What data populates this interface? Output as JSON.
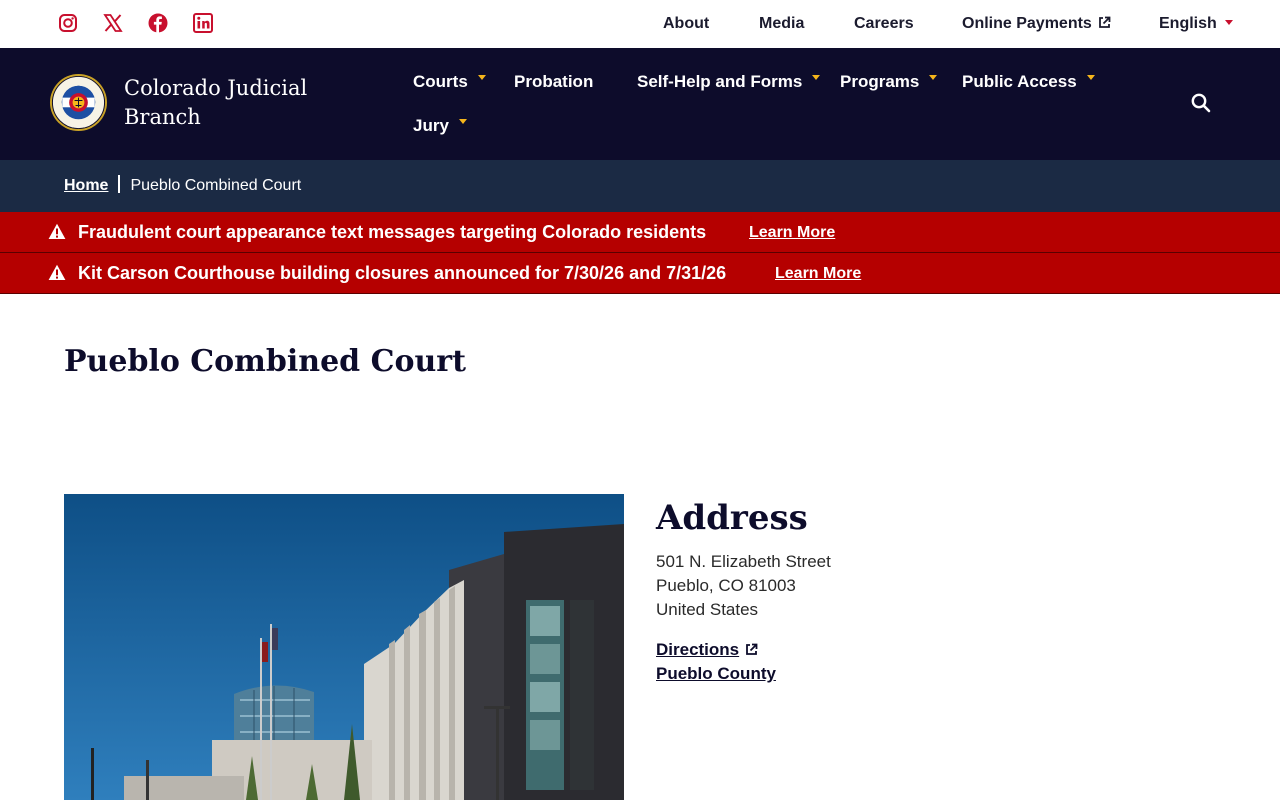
{
  "social": [
    {
      "name": "instagram-icon",
      "color": "#c8102e"
    },
    {
      "name": "x-icon",
      "color": "#c8102e"
    },
    {
      "name": "facebook-icon",
      "color": "#c8102e"
    },
    {
      "name": "linkedin-icon",
      "color": "#c8102e"
    }
  ],
  "utility": {
    "about": "About",
    "media": "Media",
    "careers": "Careers",
    "online_payments": "Online Payments",
    "language": "English"
  },
  "brand": {
    "name": "Colorado Judicial Branch",
    "name_line1": "Colorado Judicial",
    "name_line2": "Branch"
  },
  "nav": {
    "courts": "Courts",
    "probation": "Probation",
    "self_help": "Self-Help and Forms",
    "programs": "Programs",
    "public_access": "Public Access",
    "jury": "Jury"
  },
  "breadcrumb": {
    "home": "Home",
    "current": "Pueblo Combined Court"
  },
  "alerts": [
    {
      "message": "Fraudulent court appearance text messages targeting Colorado residents",
      "link": "Learn More"
    },
    {
      "message": "Kit Carson Courthouse building closures announced for 7/30/26 and 7/31/26",
      "link": "Learn More"
    }
  ],
  "page": {
    "title": "Pueblo Combined Court"
  },
  "address": {
    "heading": "Address",
    "street": "501 N. Elizabeth Street",
    "city": "Pueblo, CO 81003",
    "country": "United States",
    "directions": "Directions",
    "county": "Pueblo County"
  },
  "colors": {
    "nav_bg": "#0d0c2b",
    "breadcrumb_bg": "#1b2a44",
    "alert_bg": "#b50000",
    "accent_gold": "#f5b51b",
    "accent_red": "#c8102e"
  }
}
